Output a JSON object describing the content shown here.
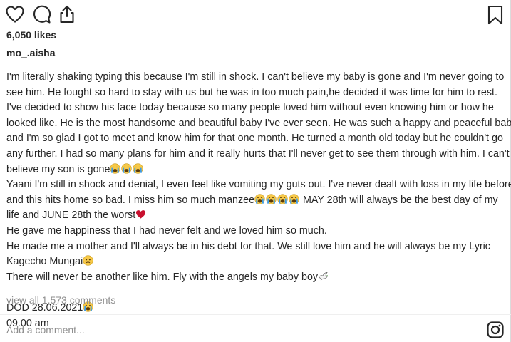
{
  "post": {
    "likes": "6,050 likes",
    "username": "mo_.aisha",
    "caption_lines": [
      [
        {
          "t": "I'm literally shaking typing this because I'm still in shock. I can't believe my baby is gone and I'm never going to"
        }
      ],
      [
        {
          "t": "see him. He fought so hard to stay with us but he was in too much pain,he decided it was time for him to rest."
        }
      ],
      [
        {
          "t": "I've decided to show his face today because so many people loved him without even knowing him or how he"
        }
      ],
      [
        {
          "t": "looked like. He is the most handsome and beautiful baby I've ever seen. He was such a happy and peaceful baby"
        }
      ],
      [
        {
          "t": "and I'm so glad I got to meet and know him for that one month. He turned a month old today but he couldn't go"
        }
      ],
      [
        {
          "t": "any further. I had so many plans for him and it really hurts that I'll never get to see them through with him. I can't"
        }
      ],
      [
        {
          "t": "believe my son is gone"
        },
        {
          "e": "crying"
        },
        {
          "e": "crying"
        },
        {
          "e": "crying"
        }
      ],
      [
        {
          "t": "Yaani I'm still in shock and denial, I even feel like vomiting my guts out. I've never dealt with loss in my life before"
        }
      ],
      [
        {
          "t": "and this hits home so bad. I miss him so much manzee"
        },
        {
          "e": "crying"
        },
        {
          "e": "crying"
        },
        {
          "e": "crying"
        },
        {
          "e": "crying"
        },
        {
          "t": " MAY 28th will always be the best day of my"
        }
      ],
      [
        {
          "t": "life and JUNE 28th the worst"
        },
        {
          "e": "heart"
        }
      ],
      [
        {
          "t": "He gave me happiness that I had never felt and we loved him so much."
        }
      ],
      [
        {
          "t": "He made me a mother and I'll always be in his debt for that. We still love him and he will always be my Lyric"
        }
      ],
      [
        {
          "t": "Kagecho Mungai"
        },
        {
          "e": "sad"
        }
      ],
      [
        {
          "t": "There will never be another like him. Fly with the angels my baby boy"
        },
        {
          "e": "dove"
        }
      ],
      [
        {
          "t": ""
        }
      ],
      [
        {
          "t": "DOD 28.06.2021"
        },
        {
          "e": "crying"
        }
      ],
      [
        {
          "t": "09.00 am"
        }
      ]
    ],
    "view_all_comments": "view all 1,573 comments",
    "comment_placeholder": "Add a comment..."
  },
  "icons": {
    "like": "heart-outline-icon",
    "comment": "comment-bubble-icon",
    "share": "share-upload-icon",
    "save": "bookmark-icon",
    "brand": "instagram-logo-icon"
  },
  "colors": {
    "text": "#262626",
    "muted": "#8e8e8e",
    "divider": "#efefef",
    "emoji_face": "#f7c948",
    "emoji_tears": "#3b9be8",
    "heart_red": "#c8102e"
  }
}
